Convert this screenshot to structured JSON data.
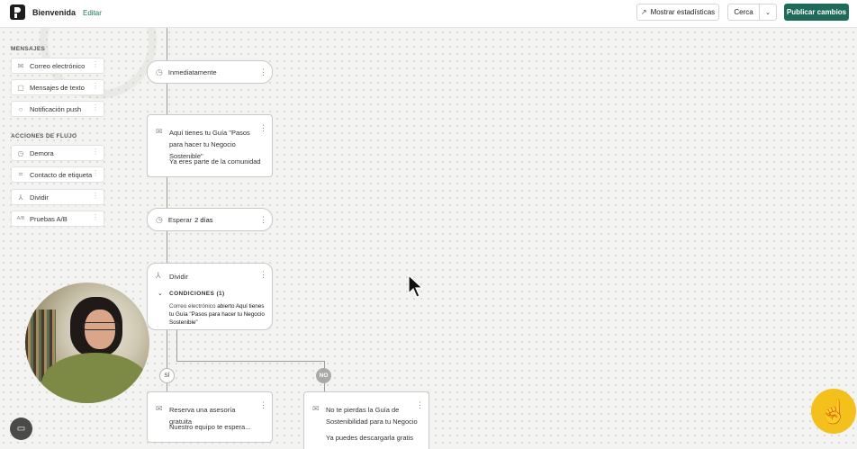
{
  "header": {
    "app_title": "Bienvenida",
    "edit_label": "Editar",
    "stats_label": "Mostrar estadísticas",
    "close_label": "Cerca",
    "caret": "⌄",
    "publish_label": "Publicar cambios"
  },
  "sidebar": {
    "messages_title": "MENSAJES",
    "messages": [
      {
        "label": "Correo electrónico",
        "icon": "mail-icon"
      },
      {
        "label": "Mensajes de texto",
        "icon": "sms-icon"
      },
      {
        "label": "Notificación push",
        "icon": "bell-icon"
      }
    ],
    "flow_title": "ACCIONES DE FLUJO",
    "flow_actions": [
      {
        "label": "Demora",
        "icon": "clock-icon"
      },
      {
        "label": "Contacto de etiqueta",
        "icon": "tag-icon"
      },
      {
        "label": "Dividir",
        "icon": "split-icon"
      },
      {
        "label": "Pruebas A/B",
        "icon": "ab-icon",
        "glyph": "A/B"
      }
    ]
  },
  "flow": {
    "immediately": "Inmediatamente",
    "email1": {
      "title": "Aquí tienes tu Guía \"Pasos para hacer tu Negocio Sostenible\"",
      "subtitle": "Ya eres parte de la comunidad"
    },
    "wait": {
      "prefix": "Esperar",
      "value": "2 días"
    },
    "split": {
      "title": "Dividir",
      "conditions_label": "CONDICIONES (1)",
      "condition_prefix": "Correo electrónico",
      "condition_text": "abierto Aquí tienes tu Guía \"Pasos para hacer tu Negocio Sostenible\""
    },
    "yes_label": "SÍ",
    "no_label": "NO",
    "email_yes": {
      "title": "Reserva una asesoría gratuita",
      "subtitle": "Nuestro equipo te espera..."
    },
    "email_no": {
      "title": "No te pierdas la Guía de Sostenibilidad para tu Negocio",
      "subtitle": "Ya puedes descargarla gratis"
    }
  }
}
